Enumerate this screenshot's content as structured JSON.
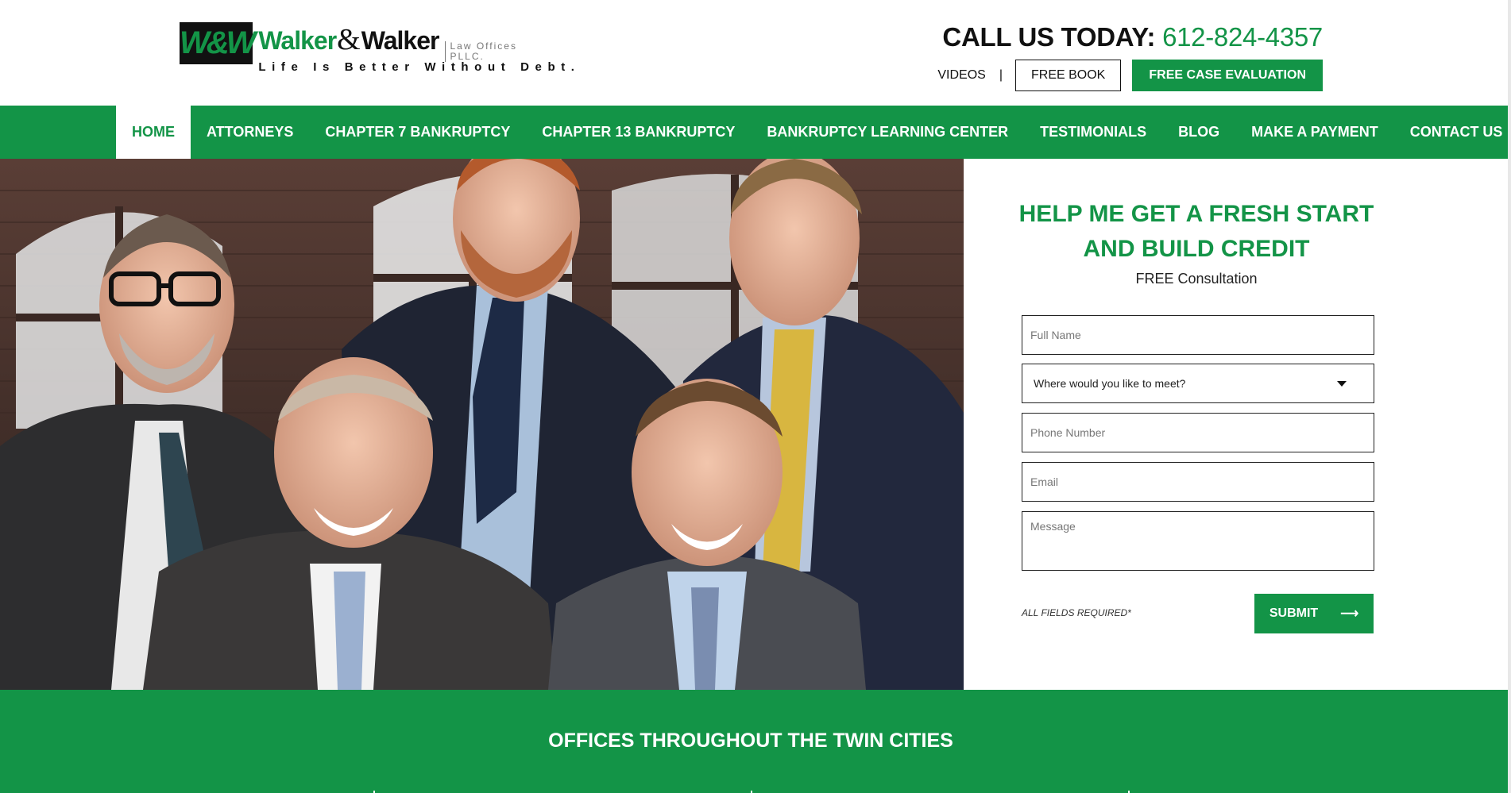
{
  "header": {
    "logo": {
      "mark": "W&W",
      "name_1": "Walker",
      "amp": "&",
      "name_2": "Walker",
      "offices": "Law Offices",
      "pllc": "PLLC.",
      "tagline": "Life Is Better Without Debt."
    },
    "call_label": "CALL US TODAY:",
    "call_phone": "612-824-4357",
    "videos_label": "VIDEOS",
    "separator": "|",
    "free_book_label": "FREE BOOK",
    "free_case_label": "FREE CASE EVALUATION"
  },
  "nav": {
    "items": [
      {
        "label": "HOME",
        "active": true
      },
      {
        "label": "ATTORNEYS"
      },
      {
        "label": "CHAPTER 7 BANKRUPTCY"
      },
      {
        "label": "CHAPTER 13 BANKRUPTCY"
      },
      {
        "label": "BANKRUPTCY LEARNING CENTER"
      },
      {
        "label": "TESTIMONIALS"
      },
      {
        "label": "BLOG"
      },
      {
        "label": "MAKE A PAYMENT"
      },
      {
        "label": "CONTACT US"
      }
    ]
  },
  "form": {
    "title_line1": "HELP ME GET A FRESH START",
    "title_line2": "AND BUILD CREDIT",
    "subtitle": "FREE Consultation",
    "name_placeholder": "Full Name",
    "meet_value": "Where would you like to meet?",
    "phone_placeholder": "Phone Number",
    "email_placeholder": "Email",
    "message_placeholder": "Message",
    "required_note": "ALL FIELDS REQUIRED*",
    "submit_label": "SUBMIT",
    "submit_arrow": "⟶"
  },
  "offices": {
    "title": "OFFICES THROUGHOUT THE TWIN CITIES"
  },
  "colors": {
    "brand_green": "#139447",
    "text_dark": "#111111",
    "white": "#ffffff"
  }
}
